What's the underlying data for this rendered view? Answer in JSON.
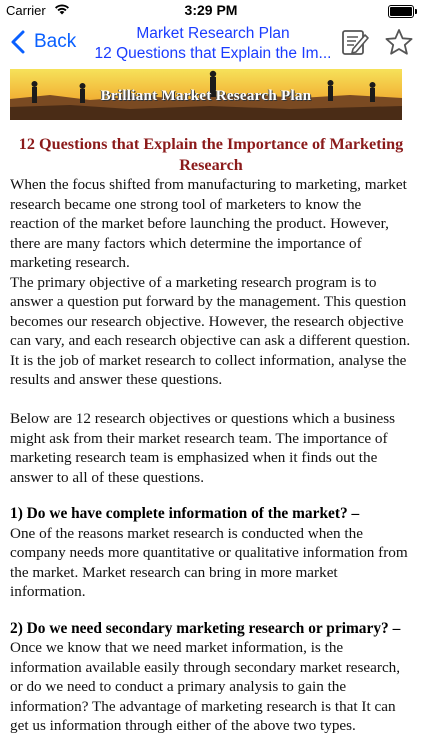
{
  "status_bar": {
    "carrier": "Carrier",
    "time": "3:29 PM"
  },
  "nav": {
    "back_label": "Back",
    "title_line1": "Market Research Plan",
    "title_line2": "12 Questions that Explain the Im...",
    "accent_color": "#0a60ff"
  },
  "banner": {
    "title": "Brilliant Market Research Plan"
  },
  "article": {
    "heading": "12 Questions that Explain the Importance of Marketing Research",
    "para1": "When the focus shifted from manufacturing to marketing, market research became one strong tool of marketers to know the reaction of the market before launching the product. However, there are many factors which determine the importance of marketing research.",
    "para2": "The primary objective of a marketing research program is to answer a question put forward by the management. This question becomes our research objective. However, the research objective can vary, and each research objective can ask a different question. It is the job of market research to collect information, analyse the results and answer these questions.",
    "para3": "Below are 12 research objectives or questions which a business might ask from their market research team. The importance of marketing research team is emphasized when it finds out the answer to all of these questions.",
    "q1_heading": "1) Do we have complete information of the market? –",
    "q1_body": "One of the reasons market research is conducted when the company needs more quantitative or qualitative information from the market. Market research can bring in more market information.",
    "q2_heading": "2) Do we need secondary marketing research or primary? –",
    "q2_body": "Once we know that we need market information, is the information available easily through secondary market research, or do we need to conduct a primary analysis to gain the information? The advantage of marketing research is that It can get us information through either of the above two types."
  }
}
